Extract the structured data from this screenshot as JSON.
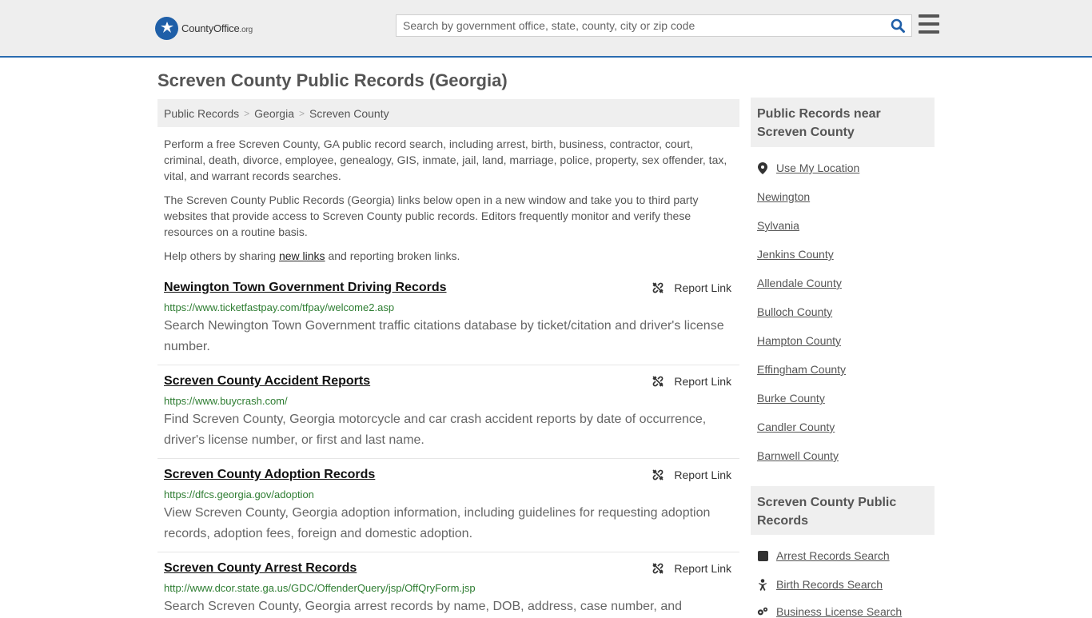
{
  "header": {
    "logo_main": "CountyOffice",
    "logo_tld": ".org",
    "search_placeholder": "Search by government office, state, county, city or zip code"
  },
  "page_title": "Screven County Public Records (Georgia)",
  "breadcrumb": [
    "Public Records",
    "Georgia",
    "Screven County"
  ],
  "intro": {
    "p1": "Perform a free Screven County, GA public record search, including arrest, birth, business, contractor, court, criminal, death, divorce, employee, genealogy, GIS, inmate, jail, land, marriage, police, property, sex offender, tax, vital, and warrant records searches.",
    "p2": "The Screven County Public Records (Georgia) links below open in a new window and take you to third party websites that provide access to Screven County public records. Editors frequently monitor and verify these resources on a routine basis.",
    "p3_before": "Help others by sharing ",
    "p3_link": "new links",
    "p3_after": " and reporting broken links."
  },
  "report_label": "Report Link",
  "records": [
    {
      "title": "Newington Town Government Driving Records",
      "url": "https://www.ticketfastpay.com/tfpay/welcome2.asp",
      "desc": "Search Newington Town Government traffic citations database by ticket/citation and driver's license number."
    },
    {
      "title": "Screven County Accident Reports",
      "url": "https://www.buycrash.com/",
      "desc": "Find Screven County, Georgia motorcycle and car crash accident reports by date of occurrence, driver's license number, or first and last name."
    },
    {
      "title": "Screven County Adoption Records",
      "url": "https://dfcs.georgia.gov/adoption",
      "desc": "View Screven County, Georgia adoption information, including guidelines for requesting adoption records, adoption fees, foreign and domestic adoption."
    },
    {
      "title": "Screven County Arrest Records",
      "url": "http://www.dcor.state.ga.us/GDC/OffenderQuery/jsp/OffQryForm.jsp",
      "desc": "Search Screven County, Georgia arrest records by name, DOB, address, case number, and"
    }
  ],
  "sidebar": {
    "nearby_heading": "Public Records near Screven County",
    "use_location": "Use My Location",
    "nearby": [
      "Newington",
      "Sylvania",
      "Jenkins County",
      "Allendale County",
      "Bulloch County",
      "Hampton County",
      "Effingham County",
      "Burke County",
      "Candler County",
      "Barnwell County"
    ],
    "records_heading": "Screven County Public Records",
    "record_links": [
      {
        "label": "Arrest Records Search",
        "icon": "square-icon"
      },
      {
        "label": "Birth Records Search",
        "icon": "baby-icon"
      },
      {
        "label": "Business License Search",
        "icon": "gears-icon"
      }
    ]
  },
  "colors": {
    "accent": "#2a6bb0",
    "url_green": "#2e7d32"
  }
}
